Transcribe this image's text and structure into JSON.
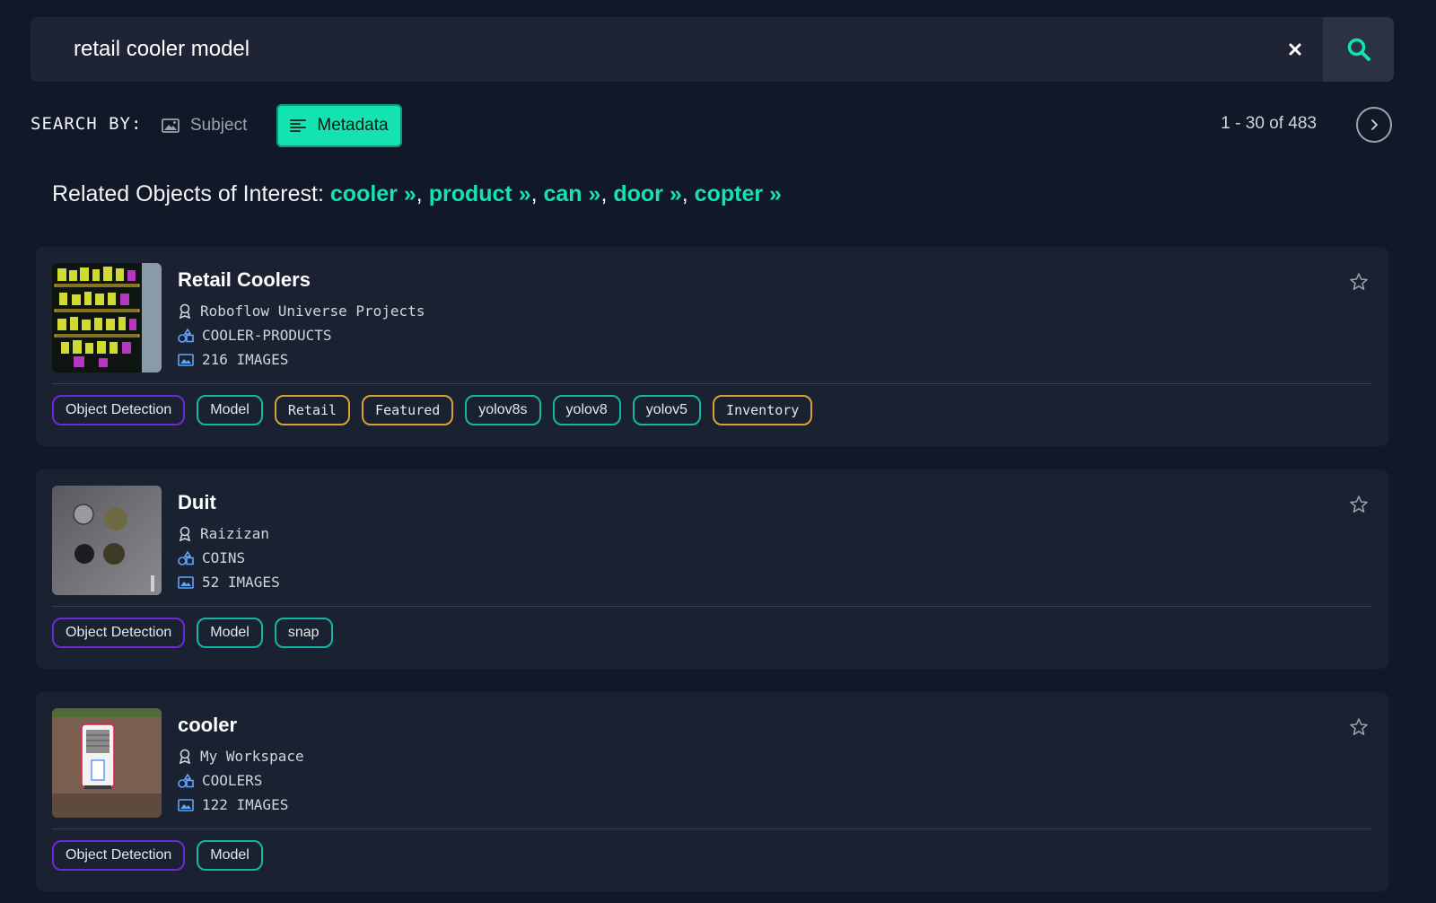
{
  "search": {
    "query": "retail cooler model",
    "clear_icon": "close-icon",
    "search_icon": "search-icon",
    "accent": "#14e2b0"
  },
  "search_by": {
    "label": "SEARCH BY:",
    "subject_label": "Subject",
    "metadata_label": "Metadata",
    "active": "Metadata"
  },
  "pagination": {
    "range_text": "1 - 30 of 483"
  },
  "related": {
    "prefix": "Related Objects of Interest:",
    "items": [
      {
        "label": "cooler",
        "arrow": "»"
      },
      {
        "label": "product",
        "arrow": "»"
      },
      {
        "label": "can",
        "arrow": "»"
      },
      {
        "label": "door",
        "arrow": "»"
      },
      {
        "label": "copter",
        "arrow": "»"
      }
    ],
    "separator": ","
  },
  "results": [
    {
      "title": "Retail Coolers",
      "workspace": "Roboflow Universe Projects",
      "classes": "COOLER-PRODUCTS",
      "images": "216 IMAGES",
      "tags": [
        {
          "label": "Object Detection",
          "color": "purple"
        },
        {
          "label": "Model",
          "color": "teal"
        },
        {
          "label": "Retail",
          "color": "amber"
        },
        {
          "label": "Featured",
          "color": "amber"
        },
        {
          "label": "yolov8s",
          "color": "teal"
        },
        {
          "label": "yolov8",
          "color": "teal"
        },
        {
          "label": "yolov5",
          "color": "teal"
        },
        {
          "label": "Inventory",
          "color": "amber"
        }
      ]
    },
    {
      "title": "Duit",
      "workspace": "Raizizan",
      "classes": "COINS",
      "images": "52 IMAGES",
      "tags": [
        {
          "label": "Object Detection",
          "color": "purple"
        },
        {
          "label": "Model",
          "color": "teal"
        },
        {
          "label": "snap",
          "color": "teal"
        }
      ]
    },
    {
      "title": "cooler",
      "workspace": "My Workspace",
      "classes": "COOLERS",
      "images": "122 IMAGES",
      "tags": [
        {
          "label": "Object Detection",
          "color": "purple"
        },
        {
          "label": "Model",
          "color": "teal"
        }
      ]
    }
  ]
}
